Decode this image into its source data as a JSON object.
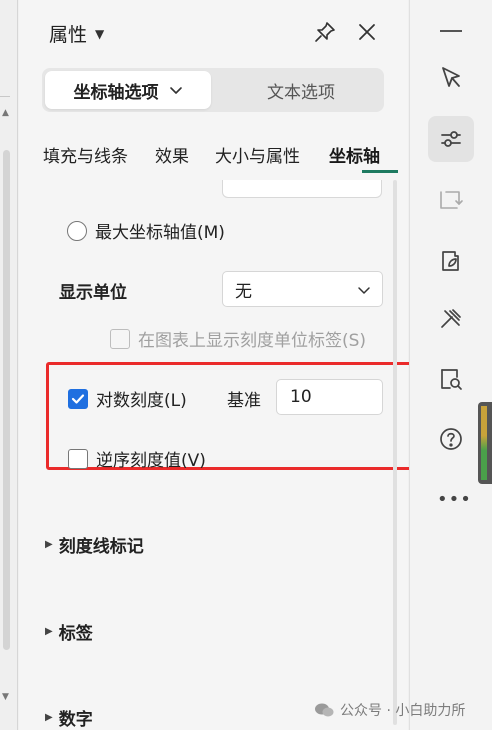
{
  "panel": {
    "title": "属性",
    "tabs_top": {
      "active": "坐标轴选项",
      "other": "文本选项"
    },
    "tabs": [
      "填充与线条",
      "效果",
      "大小与属性",
      "坐标轴"
    ],
    "active_tab": "坐标轴"
  },
  "options": {
    "max_value_label": "最大坐标轴值(M)",
    "display_unit_label": "显示单位",
    "display_unit_value": "无",
    "show_unit_label": "在图表上显示刻度单位标签(S)",
    "log_scale_label": "对数刻度(L)",
    "log_scale_checked": true,
    "base_label": "基准",
    "base_value": "10",
    "reverse_label": "逆序刻度值(V)",
    "reverse_checked": false
  },
  "sections": [
    "刻度线标记",
    "标签",
    "数字"
  ],
  "toolbar": {
    "icons": [
      "minimize-icon",
      "select-pointer-icon",
      "properties-sliders-icon",
      "transform-icon",
      "style-palette-icon",
      "tools-icon",
      "find-icon",
      "help-icon",
      "more-icon"
    ],
    "more": "•••"
  },
  "watermark": "公众号 · 小白助力所",
  "colors": {
    "highlight": "#ea2a2a",
    "checkbox_checked": "#1f6fe0",
    "active_tab_underline": "#1e7b61"
  }
}
